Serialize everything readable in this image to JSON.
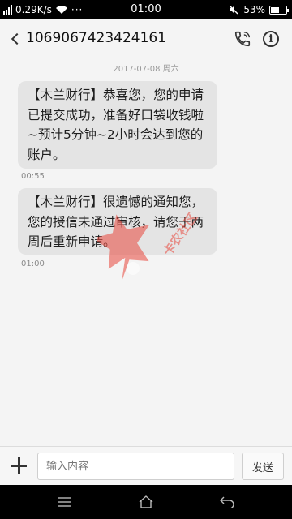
{
  "status_bar": {
    "net_speed": "0.29K/s",
    "dots": "···",
    "time": "01:00",
    "battery": "53%",
    "battery_level": 0.53
  },
  "header": {
    "contact": "1069067423424161"
  },
  "conversation": {
    "date": "2017-07-08 周六",
    "messages": [
      {
        "text": "【木兰财行】恭喜您，您的申请已提交成功，准备好口袋收钱啦~预计5分钟~2小时会达到您的账户。",
        "time": "00:55"
      },
      {
        "text": "【木兰财行】很遗憾的通知您，您的授信未通过审核，请您于两周后重新申请。",
        "time": "01:00"
      }
    ]
  },
  "watermark": {
    "text": "卡农社区"
  },
  "composer": {
    "placeholder": "输入内容",
    "send_label": "发送"
  },
  "colors": {
    "bubble": "#e4e4e4",
    "watermark": "#e8473c"
  }
}
